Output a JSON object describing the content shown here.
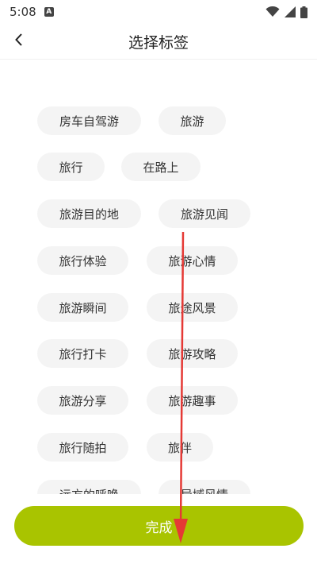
{
  "status": {
    "time": "5:08",
    "notification_icon": "A"
  },
  "nav": {
    "title": "选择标签"
  },
  "tags": [
    "房车自驾游",
    "旅游",
    "旅行",
    "在路上",
    "旅游目的地",
    "旅游见闻",
    "旅行体验",
    "旅游心情",
    "旅游瞬间",
    "旅途风景",
    "旅行打卡",
    "旅游攻略",
    "旅游分享",
    "旅游趣事",
    "旅行随拍",
    "旅伴",
    "远方的呼唤",
    "异域风情"
  ],
  "bottom": {
    "done_label": "完成"
  },
  "colors": {
    "accent": "#a9c400",
    "tag_bg": "#f4f4f4",
    "arrow": "#e53935"
  }
}
